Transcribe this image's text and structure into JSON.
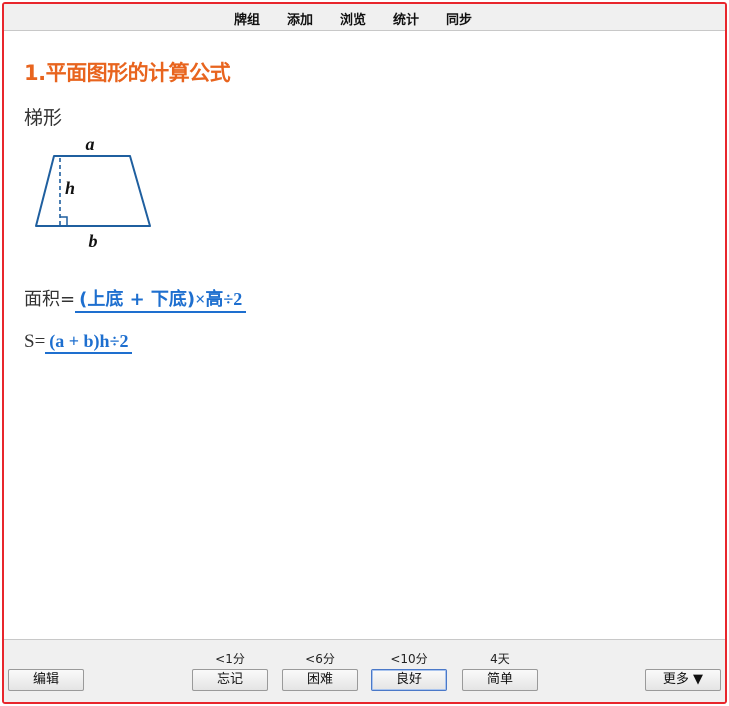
{
  "menu": {
    "items": [
      {
        "label": "牌组"
      },
      {
        "label": "添加"
      },
      {
        "label": "浏览"
      },
      {
        "label": "统计"
      },
      {
        "label": "同步"
      }
    ]
  },
  "card": {
    "section_title": "1.平面图形的计算公式",
    "shape_name": "梯形",
    "figure": {
      "top_label": "a",
      "height_label": "h",
      "bottom_label": "b"
    },
    "area_prefix": "面积=",
    "area_answer_part1": "(上底 + 下底)",
    "area_answer_part2": "×高÷2",
    "s_prefix": "S=",
    "s_answer": "(a + b)h÷2"
  },
  "review": {
    "intervals": [
      "<1分",
      "<6分",
      "<10分",
      "4天"
    ],
    "buttons": [
      "忘记",
      "困难",
      "良好",
      "简单"
    ],
    "edit_label": "编辑",
    "more_label": "更多 ▼"
  },
  "colors": {
    "title": "#e8641e",
    "answer": "#1e6fcf",
    "figure_line": "#1f5f9f",
    "window_border": "#e8262c"
  }
}
